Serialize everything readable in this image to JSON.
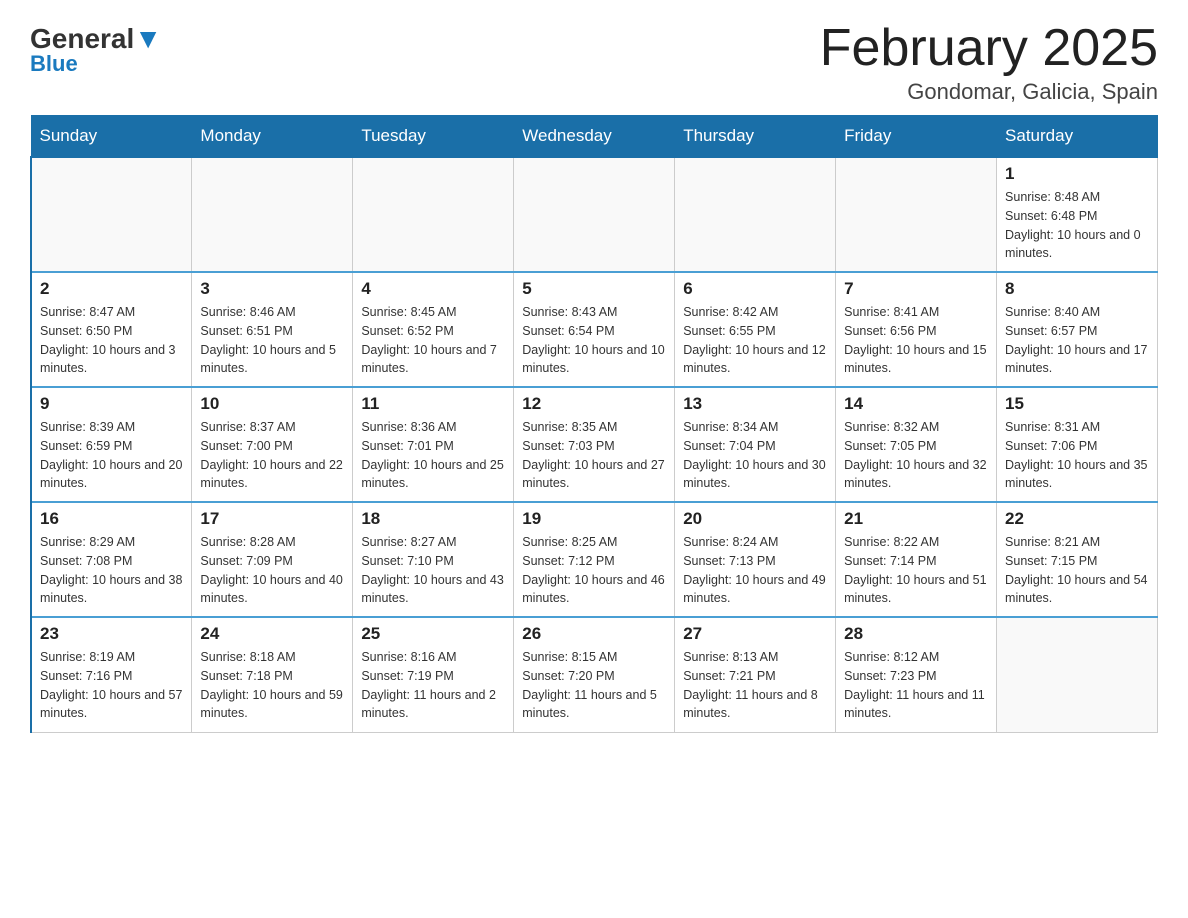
{
  "header": {
    "logo_general": "General",
    "logo_blue": "Blue",
    "month_title": "February 2025",
    "subtitle": "Gondomar, Galicia, Spain"
  },
  "days_of_week": [
    "Sunday",
    "Monday",
    "Tuesday",
    "Wednesday",
    "Thursday",
    "Friday",
    "Saturday"
  ],
  "weeks": [
    [
      {
        "num": "",
        "info": ""
      },
      {
        "num": "",
        "info": ""
      },
      {
        "num": "",
        "info": ""
      },
      {
        "num": "",
        "info": ""
      },
      {
        "num": "",
        "info": ""
      },
      {
        "num": "",
        "info": ""
      },
      {
        "num": "1",
        "info": "Sunrise: 8:48 AM\nSunset: 6:48 PM\nDaylight: 10 hours and 0 minutes."
      }
    ],
    [
      {
        "num": "2",
        "info": "Sunrise: 8:47 AM\nSunset: 6:50 PM\nDaylight: 10 hours and 3 minutes."
      },
      {
        "num": "3",
        "info": "Sunrise: 8:46 AM\nSunset: 6:51 PM\nDaylight: 10 hours and 5 minutes."
      },
      {
        "num": "4",
        "info": "Sunrise: 8:45 AM\nSunset: 6:52 PM\nDaylight: 10 hours and 7 minutes."
      },
      {
        "num": "5",
        "info": "Sunrise: 8:43 AM\nSunset: 6:54 PM\nDaylight: 10 hours and 10 minutes."
      },
      {
        "num": "6",
        "info": "Sunrise: 8:42 AM\nSunset: 6:55 PM\nDaylight: 10 hours and 12 minutes."
      },
      {
        "num": "7",
        "info": "Sunrise: 8:41 AM\nSunset: 6:56 PM\nDaylight: 10 hours and 15 minutes."
      },
      {
        "num": "8",
        "info": "Sunrise: 8:40 AM\nSunset: 6:57 PM\nDaylight: 10 hours and 17 minutes."
      }
    ],
    [
      {
        "num": "9",
        "info": "Sunrise: 8:39 AM\nSunset: 6:59 PM\nDaylight: 10 hours and 20 minutes."
      },
      {
        "num": "10",
        "info": "Sunrise: 8:37 AM\nSunset: 7:00 PM\nDaylight: 10 hours and 22 minutes."
      },
      {
        "num": "11",
        "info": "Sunrise: 8:36 AM\nSunset: 7:01 PM\nDaylight: 10 hours and 25 minutes."
      },
      {
        "num": "12",
        "info": "Sunrise: 8:35 AM\nSunset: 7:03 PM\nDaylight: 10 hours and 27 minutes."
      },
      {
        "num": "13",
        "info": "Sunrise: 8:34 AM\nSunset: 7:04 PM\nDaylight: 10 hours and 30 minutes."
      },
      {
        "num": "14",
        "info": "Sunrise: 8:32 AM\nSunset: 7:05 PM\nDaylight: 10 hours and 32 minutes."
      },
      {
        "num": "15",
        "info": "Sunrise: 8:31 AM\nSunset: 7:06 PM\nDaylight: 10 hours and 35 minutes."
      }
    ],
    [
      {
        "num": "16",
        "info": "Sunrise: 8:29 AM\nSunset: 7:08 PM\nDaylight: 10 hours and 38 minutes."
      },
      {
        "num": "17",
        "info": "Sunrise: 8:28 AM\nSunset: 7:09 PM\nDaylight: 10 hours and 40 minutes."
      },
      {
        "num": "18",
        "info": "Sunrise: 8:27 AM\nSunset: 7:10 PM\nDaylight: 10 hours and 43 minutes."
      },
      {
        "num": "19",
        "info": "Sunrise: 8:25 AM\nSunset: 7:12 PM\nDaylight: 10 hours and 46 minutes."
      },
      {
        "num": "20",
        "info": "Sunrise: 8:24 AM\nSunset: 7:13 PM\nDaylight: 10 hours and 49 minutes."
      },
      {
        "num": "21",
        "info": "Sunrise: 8:22 AM\nSunset: 7:14 PM\nDaylight: 10 hours and 51 minutes."
      },
      {
        "num": "22",
        "info": "Sunrise: 8:21 AM\nSunset: 7:15 PM\nDaylight: 10 hours and 54 minutes."
      }
    ],
    [
      {
        "num": "23",
        "info": "Sunrise: 8:19 AM\nSunset: 7:16 PM\nDaylight: 10 hours and 57 minutes."
      },
      {
        "num": "24",
        "info": "Sunrise: 8:18 AM\nSunset: 7:18 PM\nDaylight: 10 hours and 59 minutes."
      },
      {
        "num": "25",
        "info": "Sunrise: 8:16 AM\nSunset: 7:19 PM\nDaylight: 11 hours and 2 minutes."
      },
      {
        "num": "26",
        "info": "Sunrise: 8:15 AM\nSunset: 7:20 PM\nDaylight: 11 hours and 5 minutes."
      },
      {
        "num": "27",
        "info": "Sunrise: 8:13 AM\nSunset: 7:21 PM\nDaylight: 11 hours and 8 minutes."
      },
      {
        "num": "28",
        "info": "Sunrise: 8:12 AM\nSunset: 7:23 PM\nDaylight: 11 hours and 11 minutes."
      },
      {
        "num": "",
        "info": ""
      }
    ]
  ]
}
